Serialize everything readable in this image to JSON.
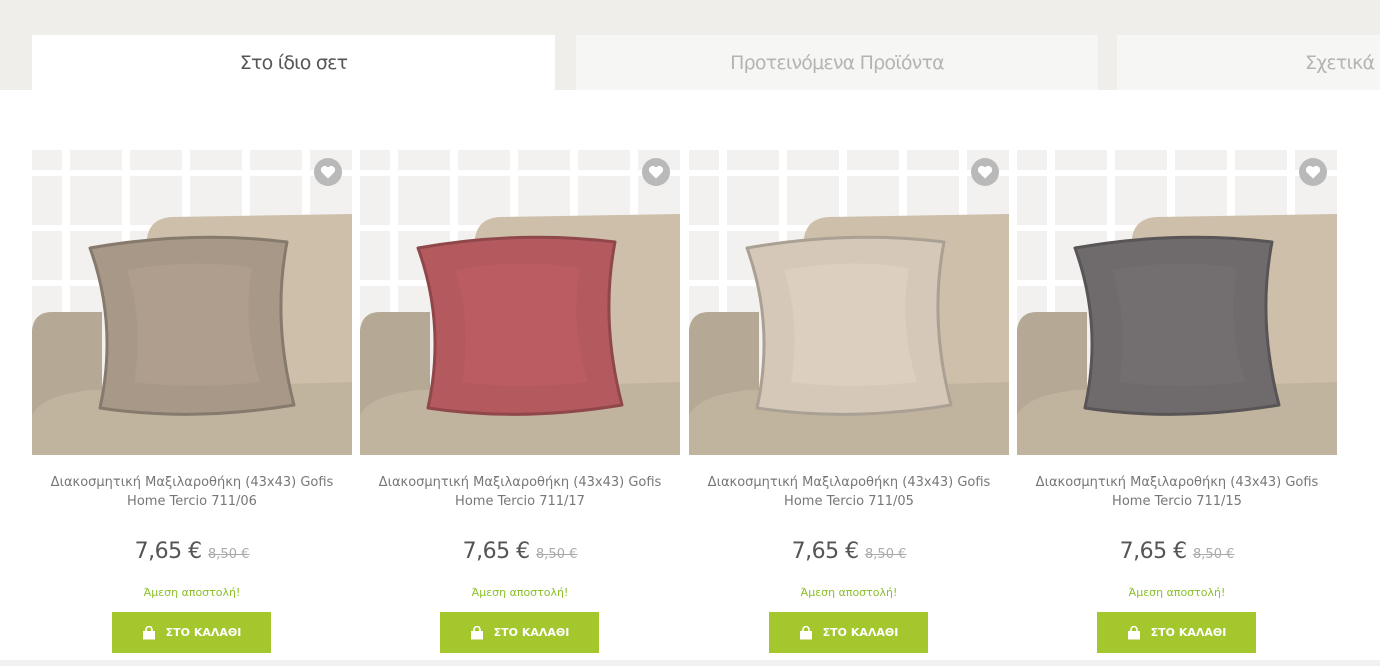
{
  "tabs": [
    {
      "label": "Στο ίδιο σετ",
      "active": true
    },
    {
      "label": "Προτεινόμενα Προϊόντα",
      "active": false
    },
    {
      "label": "Σχετικά Π",
      "active": false
    }
  ],
  "products": [
    {
      "title": "Διακοσμητική Μαξιλαροθήκη (43x43) Gofis Home Tercio 711/06",
      "price": "7,65 €",
      "old_price": "8,50 €",
      "shipping": "Άμεση αποστολή!",
      "cart_label": "ΣΤΟ ΚΑΛΑΘΙ",
      "pillow_color": "#a89888"
    },
    {
      "title": "Διακοσμητική Μαξιλαροθήκη (43x43) Gofis Home Tercio 711/17",
      "price": "7,65 €",
      "old_price": "8,50 €",
      "shipping": "Άμεση αποστολή!",
      "cart_label": "ΣΤΟ ΚΑΛΑΘΙ",
      "pillow_color": "#b4595d"
    },
    {
      "title": "Διακοσμητική Μαξιλαροθήκη (43x43) Gofis Home Tercio 711/05",
      "price": "7,65 €",
      "old_price": "8,50 €",
      "shipping": "Άμεση αποστολή!",
      "cart_label": "ΣΤΟ ΚΑΛΑΘΙ",
      "pillow_color": "#d5c8b8"
    },
    {
      "title": "Διακοσμητική Μαξιλαροθήκη (43x43) Gofis Home Tercio 711/15",
      "price": "7,65 €",
      "old_price": "8,50 €",
      "shipping": "Άμεση αποστολή!",
      "cart_label": "ΣΤΟ ΚΑΛΑΘΙ",
      "pillow_color": "#6f6a6c"
    }
  ],
  "colors": {
    "accent": "#a3c72d",
    "shipping_text": "#8bbf2a",
    "sofa": "#c9bba6"
  },
  "icons": {
    "wishlist": "heart-icon",
    "cart": "shopping-bag-icon"
  }
}
